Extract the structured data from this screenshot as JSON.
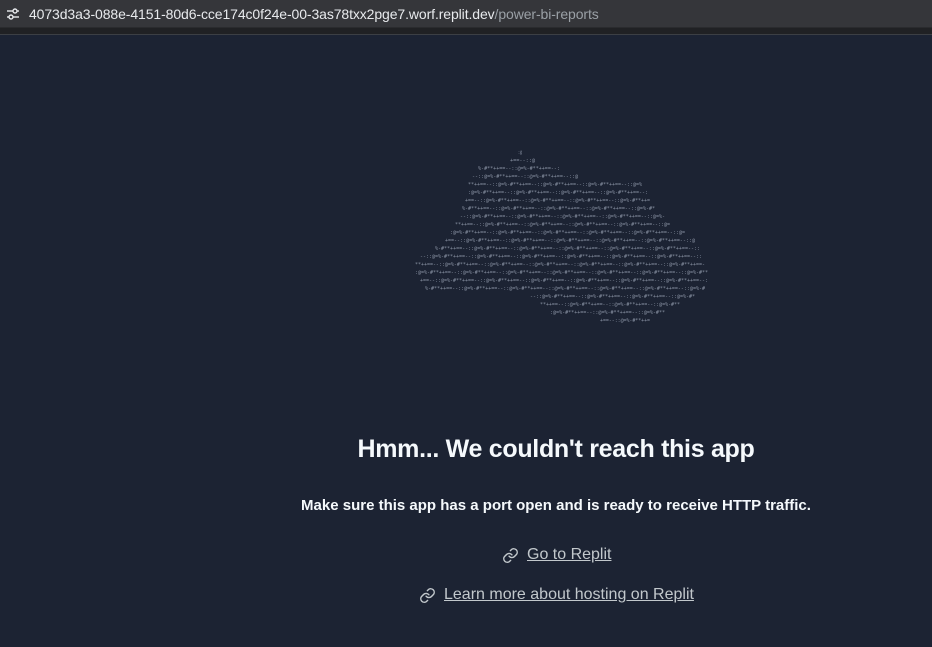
{
  "browser": {
    "url_host": "4073d3a3-088e-4151-80d6-cce174c0f24e-00-3as78txx2pge7.worf.replit.dev",
    "url_path": "/power-bi-reports",
    "site_info_icon": "tune-icon"
  },
  "error": {
    "illustration_icon": "ascii-cloud-icon",
    "heading": "Hmm... We couldn't reach this app",
    "message": "Make sure this app has a port open and is ready to receive HTTP traffic.",
    "links": [
      {
        "label": "Go to Replit",
        "icon": "link-icon"
      },
      {
        "label": "Learn more about hosting on Replit",
        "icon": "link-icon"
      }
    ]
  },
  "colors": {
    "background": "#1c2333",
    "text": "#f5f9fc",
    "link": "#c2c8cc"
  }
}
